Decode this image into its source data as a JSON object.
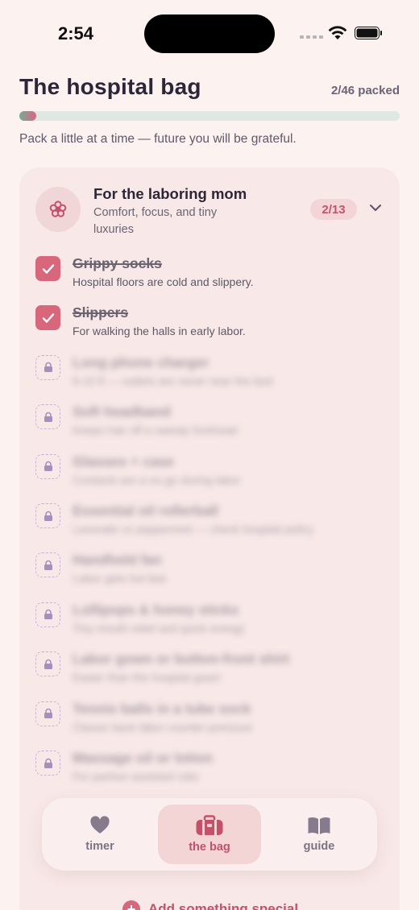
{
  "status": {
    "time": "2:54"
  },
  "header": {
    "title": "The hospital bag",
    "packed_label": "2/46 packed",
    "progress": 0.0435,
    "tagline": "Pack a little at a time — future you will be grateful."
  },
  "category": {
    "icon": "flower-icon",
    "title": "For the laboring mom",
    "subtitle": "Comfort, focus, and tiny luxuries",
    "count": "2/13",
    "items": [
      {
        "title": "Grippy socks",
        "desc": "Hospital floors are cold and slippery.",
        "checked": true
      },
      {
        "title": "Slippers",
        "desc": "For walking the halls in early labor.",
        "checked": true
      },
      {
        "title": "Long phone charger",
        "desc": "6-10 ft — outlets are never near the bed",
        "checked": false
      },
      {
        "title": "Soft headband",
        "desc": "Keeps hair off a sweaty forehead",
        "checked": false
      },
      {
        "title": "Glasses + case",
        "desc": "Contacts are a no-go during labor",
        "checked": false
      },
      {
        "title": "Essential oil rollerball",
        "desc": "Lavender or peppermint — check hospital policy",
        "checked": false
      },
      {
        "title": "Handheld fan",
        "desc": "Labor gets hot fast",
        "checked": false
      },
      {
        "title": "Lollipops & honey sticks",
        "desc": "Tiny mouth relief and quick energy",
        "checked": false
      },
      {
        "title": "Labor gown or button-front shirt",
        "desc": "Easier than the hospital gown",
        "checked": false
      },
      {
        "title": "Tennis balls in a tube sock",
        "desc": "Classic back labor counter-pressure",
        "checked": false
      },
      {
        "title": "Massage oil or lotion",
        "desc": "For partner-assisted rubs",
        "checked": false
      }
    ]
  },
  "tabs": [
    {
      "label": "timer",
      "icon": "heart-icon",
      "active": false
    },
    {
      "label": "the bag",
      "icon": "bag-icon",
      "active": true
    },
    {
      "label": "guide",
      "icon": "book-icon",
      "active": false
    }
  ],
  "add_label": "Add something special",
  "colors": {
    "accent": "#d9677c",
    "accent_text": "#c4516a",
    "background": "#fcf3f1",
    "card": "#f8e9e8",
    "progress_track": "#dfe9e4"
  }
}
